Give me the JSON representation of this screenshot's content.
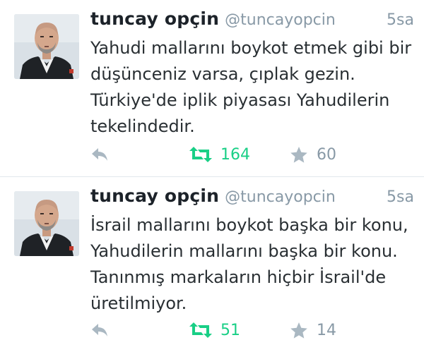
{
  "tweets": [
    {
      "author_name": "tuncay opçin",
      "handle": "@tuncayopcin",
      "time": "5sa",
      "lines": [
        "Yahudi mallarını boykot etmek gibi bir",
        "düşünceniz varsa, çıplak gezin.",
        "Türkiye'de iplik piyasası Yahudilerin",
        "tekelindedir."
      ],
      "retweets": "164",
      "favorites": "60"
    },
    {
      "author_name": "tuncay opçin",
      "handle": "@tuncayopcin",
      "time": "5sa",
      "lines": [
        "İsrail mallarını boykot başka bir konu,",
        "Yahudilerin mallarını başka bir konu.",
        "Tanınmış markaların hiçbir İsrail'de",
        "üretilmiyor."
      ],
      "retweets": "51",
      "favorites": "14"
    }
  ],
  "icons": {
    "reply": "reply-icon",
    "retweet": "retweet-icon",
    "favorite": "star-icon"
  },
  "colors": {
    "retweet_green": "#19cf86",
    "muted_gray": "#8899a6",
    "icon_gray": "#aab8c2",
    "divider": "#e1e8ed"
  }
}
